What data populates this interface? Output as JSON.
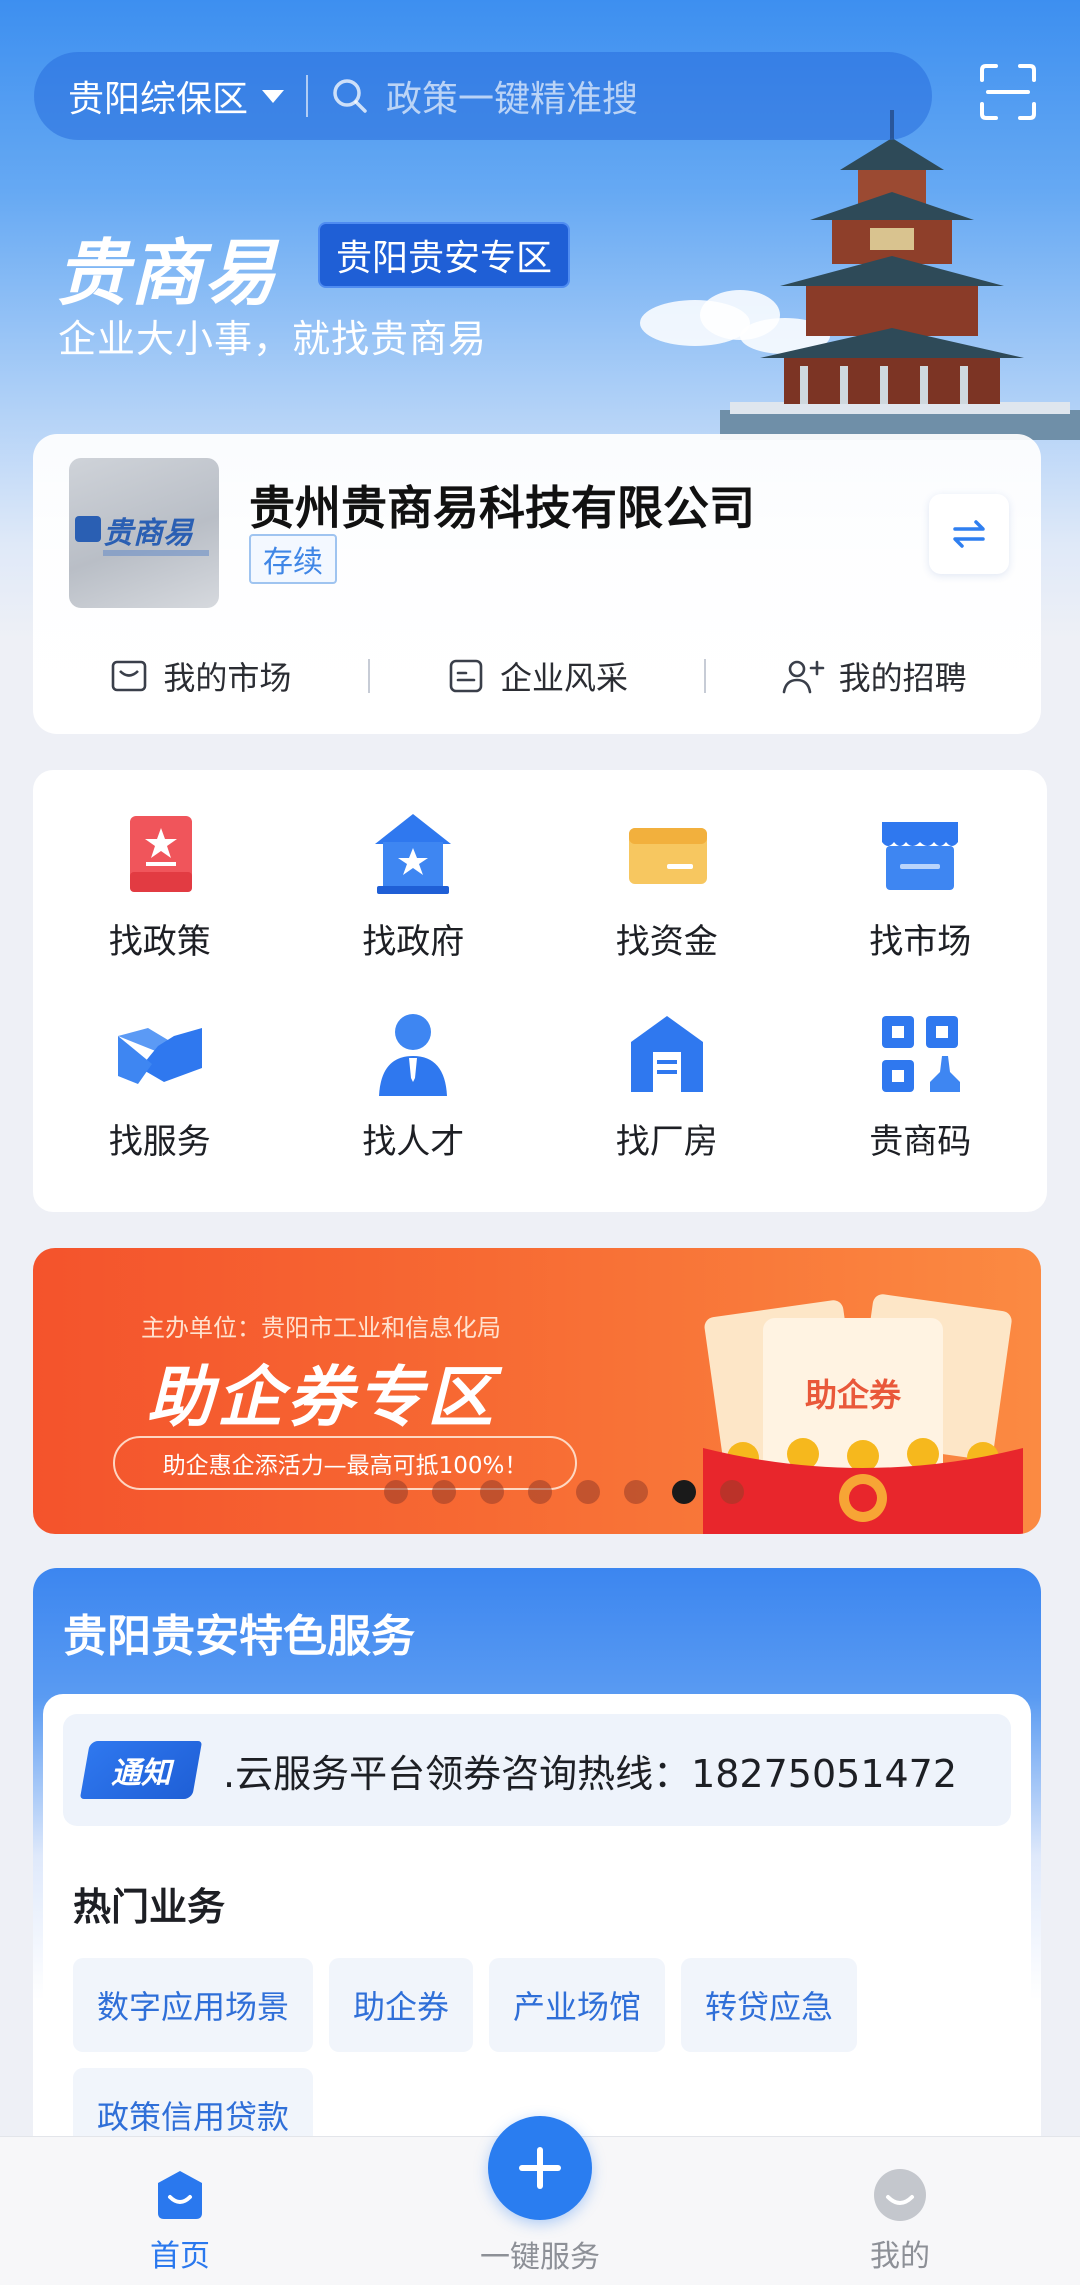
{
  "header": {
    "region": "贵阳综保区",
    "search_placeholder": "政策一键精准搜",
    "brand": "贵商易",
    "zone_tag": "贵阳贵安专区",
    "slogan": "企业大小事，就找贵商易",
    "logo_text": "贵商易"
  },
  "company": {
    "name": "贵州贵商易科技有限公司",
    "status": "存续",
    "links": [
      {
        "label": "我的市场",
        "icon": "inbox-icon"
      },
      {
        "label": "企业风采",
        "icon": "id-card-icon"
      },
      {
        "label": "我的招聘",
        "icon": "add-user-icon"
      }
    ]
  },
  "grid": [
    {
      "label": "找政策",
      "icon": "policy-icon"
    },
    {
      "label": "找政府",
      "icon": "government-icon"
    },
    {
      "label": "找资金",
      "icon": "card-icon"
    },
    {
      "label": "找市场",
      "icon": "market-icon"
    },
    {
      "label": "找服务",
      "icon": "handshake-icon"
    },
    {
      "label": "找人才",
      "icon": "talent-icon"
    },
    {
      "label": "找厂房",
      "icon": "factory-icon"
    },
    {
      "label": "贵商码",
      "icon": "qr-code-icon"
    }
  ],
  "banner": {
    "host": "主办单位：贵阳市工业和信息化局",
    "title": "助企券专区",
    "subtitle": "助企惠企添活力—最高可抵100%！",
    "coupon_label": "助企券",
    "slide_count": 8,
    "active_slide": 7
  },
  "special": {
    "title": "贵阳贵安特色服务",
    "notice_tag": "通知",
    "notice_text": ".云服务平台领券咨询热线：18275051472",
    "hot_title": "热门业务",
    "chips": [
      "数字应用场景",
      "助企券",
      "产业场馆",
      "转贷应急",
      "政策信用贷款"
    ]
  },
  "nav": {
    "home": "首页",
    "service": "一键服务",
    "mine": "我的"
  },
  "colors": {
    "primary": "#2a7df0",
    "banner": "#f4532c",
    "accent_text": "#2f6fd8"
  }
}
